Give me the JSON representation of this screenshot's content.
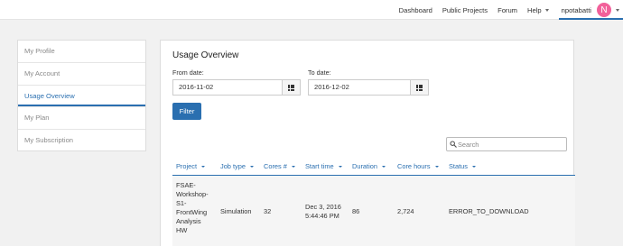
{
  "nav": {
    "items": [
      "Dashboard",
      "Public Projects",
      "Forum"
    ],
    "help": "Help",
    "username": "npotabatti",
    "avatar_letter": "N"
  },
  "sidebar": {
    "items": [
      "My Profile",
      "My Account",
      "Usage Overview",
      "My Plan",
      "My Subscription"
    ],
    "active": "Usage Overview"
  },
  "main": {
    "title": "Usage Overview",
    "from_label": "From date:",
    "from_value": "2016-11-02",
    "to_label": "To date:",
    "to_value": "2016-12-02",
    "filter_label": "Filter",
    "search_placeholder": "Search",
    "columns": [
      "Project",
      "Job type",
      "Cores #",
      "Start time",
      "Duration",
      "Core hours",
      "Status"
    ],
    "rows": [
      {
        "project": "FSAE-Workshop-S1-FrontWing Analysis HW",
        "project_lines": [
          "FSAE-",
          "Workshop-",
          "S1-",
          "FrontWing",
          "Analysis",
          "HW"
        ],
        "job_type": "Simulation",
        "cores": "32",
        "start_time": "Dec 3, 2016 5:44:46 PM",
        "start_lines": [
          "Dec 3, 2016",
          "5:44:46 PM"
        ],
        "duration": "86",
        "core_hours": "2,724",
        "status": "ERROR_TO_DOWNLOAD"
      }
    ]
  },
  "colors": {
    "accent": "#2a6fb0",
    "avatar": "#f2609a",
    "background": "#f1f1f1"
  }
}
